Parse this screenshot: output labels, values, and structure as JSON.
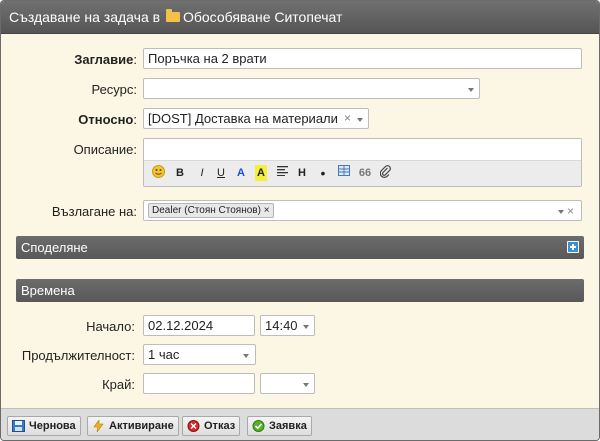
{
  "window": {
    "title_prefix": "Създаване на задача в",
    "project": "Обособяване Ситопечат"
  },
  "form": {
    "title_label": "Заглавие",
    "title_value": "Поръчка на 2 врати",
    "resource_label": "Ресурс:",
    "resource_value": "",
    "relates_label": "Относно",
    "relates_value": "[DOST] Доставка на материали",
    "description_label": "Описание:",
    "editor_toolbar": [
      "smiley-icon",
      "bold",
      "italic",
      "underline",
      "text-color",
      "highlight",
      "align",
      "heading",
      "bullet",
      "table-icon",
      "quote-icon",
      "attach-icon"
    ],
    "editor_labels": {
      "bold": "B",
      "italic": "I",
      "underline": "U",
      "color": "A",
      "highlight": "A",
      "heading": "H",
      "bullet": "•",
      "quote": "66"
    },
    "assign_label": "Възлагане на:",
    "assignee": "Dealer (Стоян Стоянов)"
  },
  "sections": {
    "sharing": "Споделяне",
    "times": "Времена"
  },
  "times": {
    "start_label": "Начало:",
    "start_date": "02.12.2024",
    "start_time": "14:40",
    "duration_label": "Продължителност:",
    "duration_value": "1 час",
    "end_label": "Край:",
    "end_date": "",
    "end_time": ""
  },
  "buttons": {
    "draft": "Чернова",
    "activate": "Активиране",
    "cancel": "Отказ",
    "request": "Заявка"
  },
  "colors": {
    "accent_blue": "#3a8fd9",
    "background": "#fbf7e4",
    "section_header": "#626262"
  }
}
